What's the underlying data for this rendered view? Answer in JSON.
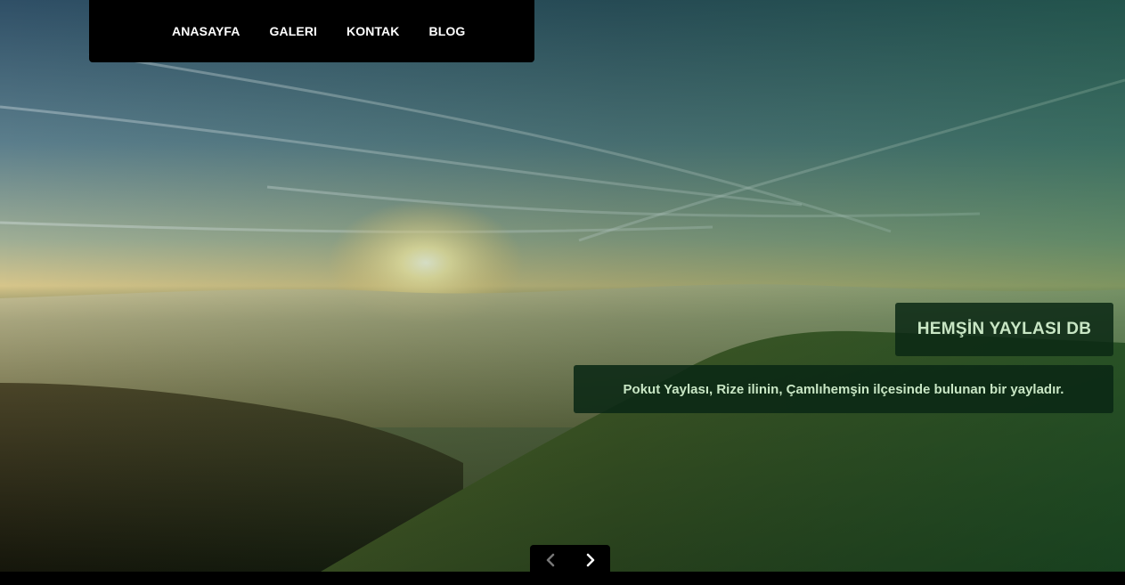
{
  "nav": {
    "items": [
      {
        "label": "ANASAYFA"
      },
      {
        "label": "GALERI"
      },
      {
        "label": "KONTAK"
      },
      {
        "label": "BLOG"
      }
    ]
  },
  "slide": {
    "title": "HEMŞİN YAYLASI DB",
    "description": "Pokut Yaylası, Rize ilinin, Çamlıhemşin ilçesinde bulunan bir yayladır."
  },
  "controls": {
    "prev_icon": "chevron-left-icon",
    "next_icon": "chevron-right-icon"
  },
  "colors": {
    "navbar_bg": "#000000",
    "caption_bg": "#0a2814",
    "caption_text": "#c8e6c4"
  }
}
